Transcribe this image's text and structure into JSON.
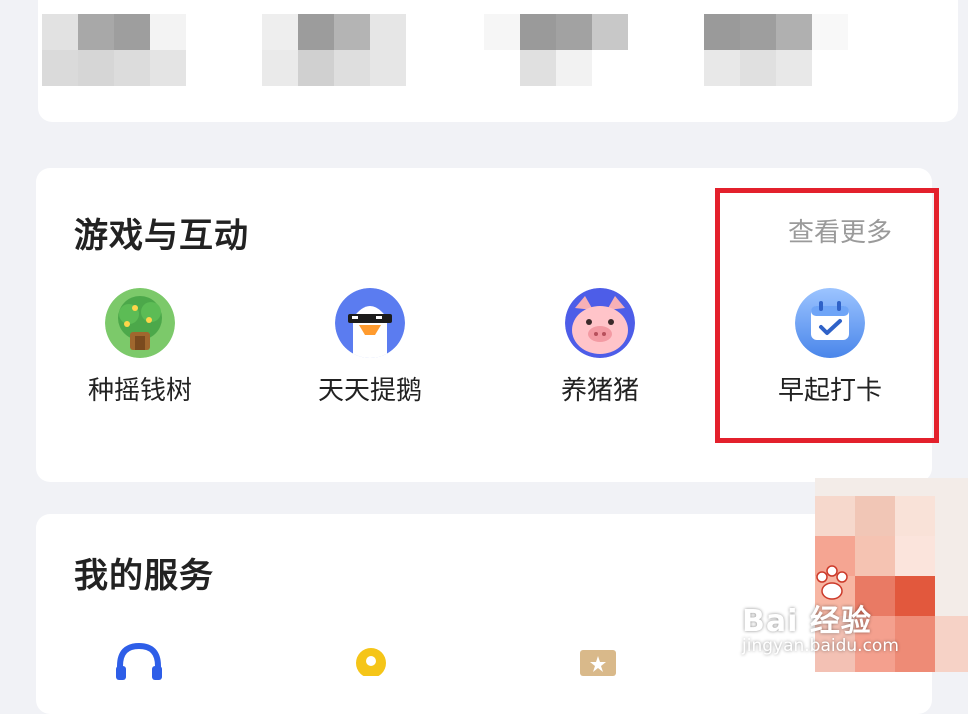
{
  "games_section": {
    "title": "游戏与互动",
    "more_label": "查看更多",
    "items": [
      {
        "label": "种摇钱树",
        "icon": "money-tree-icon"
      },
      {
        "label": "天天提鹅",
        "icon": "goose-icon"
      },
      {
        "label": "养猪猪",
        "icon": "pig-icon"
      },
      {
        "label": "早起打卡",
        "icon": "calendar-check-icon"
      }
    ]
  },
  "services_section": {
    "title": "我的服务",
    "icons": [
      "headset-icon",
      "location-pin-icon",
      "star-card-icon"
    ]
  },
  "watermark": {
    "brand": "Bai 经验",
    "url": "jingyan.baidu.com"
  },
  "colors": {
    "highlight": "#e3202c",
    "card": "#ffffff",
    "background": "#f1f2f6"
  }
}
